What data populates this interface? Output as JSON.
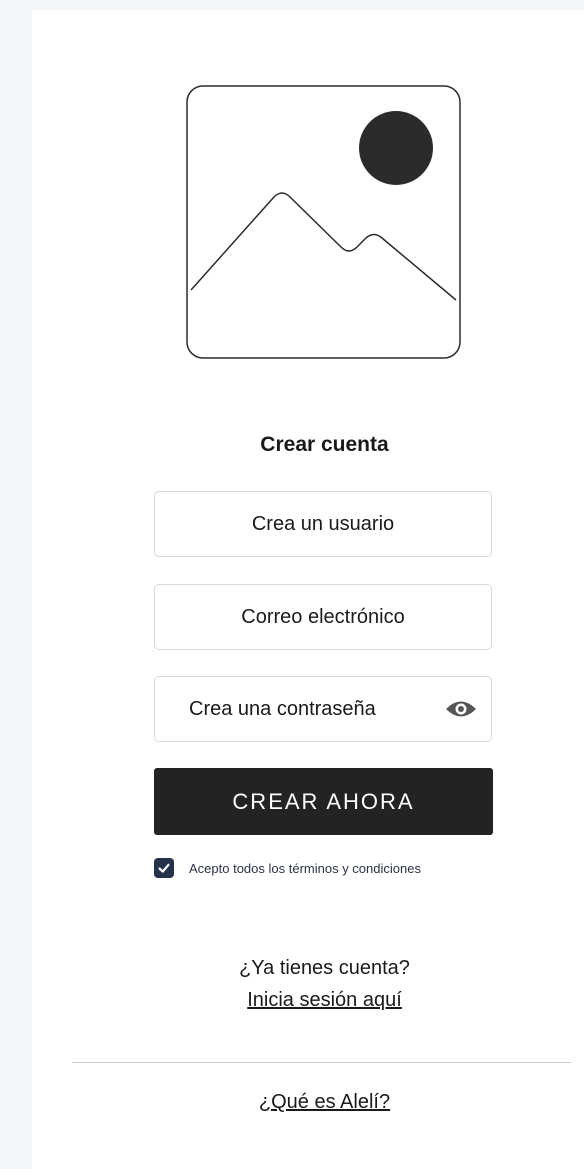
{
  "header": {
    "title": "Crear cuenta",
    "image_icon": "image-placeholder-icon"
  },
  "form": {
    "username_placeholder": "Crea un usuario",
    "email_placeholder": "Correo electrónico",
    "password_placeholder": "Crea una contraseña",
    "password_toggle_icon": "eye-icon",
    "submit_label": "CREAR AHORA",
    "terms_label": "Acepto todos los términos y condiciones",
    "terms_checked": true
  },
  "footer": {
    "have_account": "¿Ya tienes cuenta?",
    "login_link": "Inicia sesión aquí",
    "about_link": "¿Qué es Alelí?"
  },
  "colors": {
    "background": "#f3f6fb",
    "card": "#ffffff",
    "button": "#232323",
    "checkbox": "#24324a",
    "field_border": "#d7d9dc"
  }
}
